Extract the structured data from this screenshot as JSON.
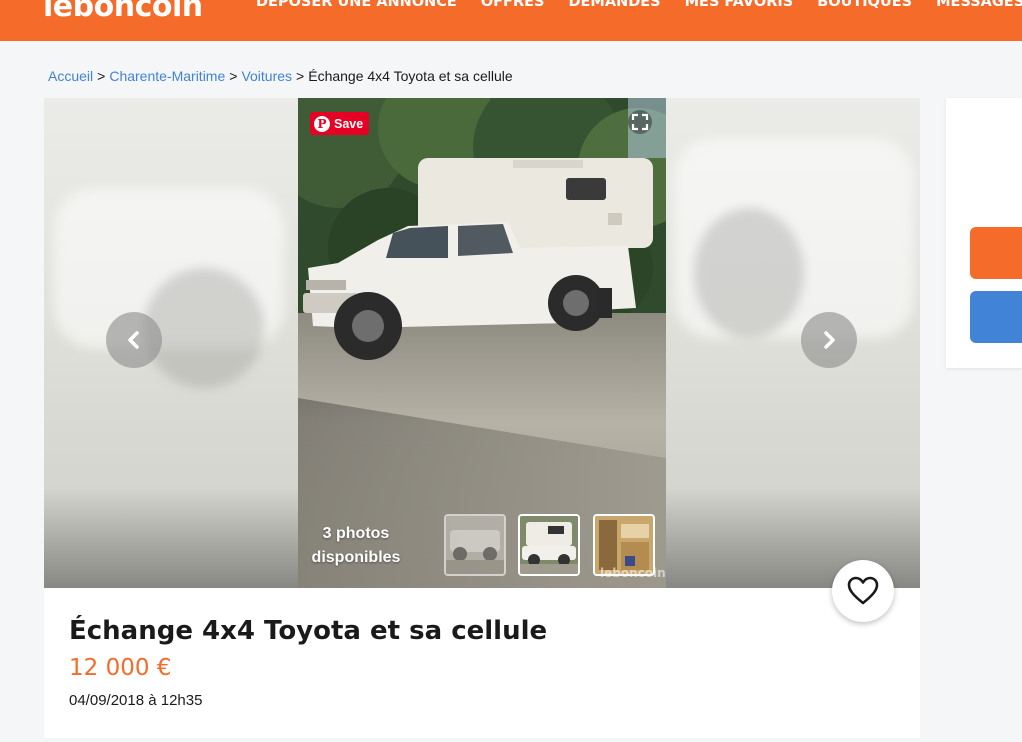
{
  "header": {
    "logo": "leboncoin",
    "nav": [
      {
        "label": "DÉPOSER UNE ANNONCE"
      },
      {
        "label": "OFFRES"
      },
      {
        "label": "DEMANDES"
      },
      {
        "label": "MES FAVORIS"
      },
      {
        "label": "BOUTIQUES"
      },
      {
        "label": "MESSAGES"
      }
    ]
  },
  "breadcrumb": {
    "items": [
      "Accueil",
      "Charente-Maritime",
      "Voitures"
    ],
    "separator": ">",
    "current": "Échange 4x4 Toyota et sa cellule"
  },
  "gallery": {
    "save_label": "Save",
    "pin_icon": "pinterest-icon",
    "photo_count_line1": "3 photos",
    "photo_count_line2": "disponibles",
    "watermark": "leboncoin",
    "prev_icon": "chevron-left-icon",
    "next_icon": "chevron-right-icon",
    "fullscreen_icon": "fullscreen-icon"
  },
  "ad": {
    "title": "Échange 4x4 Toyota et sa cellule",
    "price": "12 000 €",
    "date": "04/09/2018 à 12h35",
    "favorite_icon": "heart-icon"
  },
  "colors": {
    "brand": "#f56b2a",
    "link": "#4183d7",
    "pinterest": "#e60023"
  }
}
